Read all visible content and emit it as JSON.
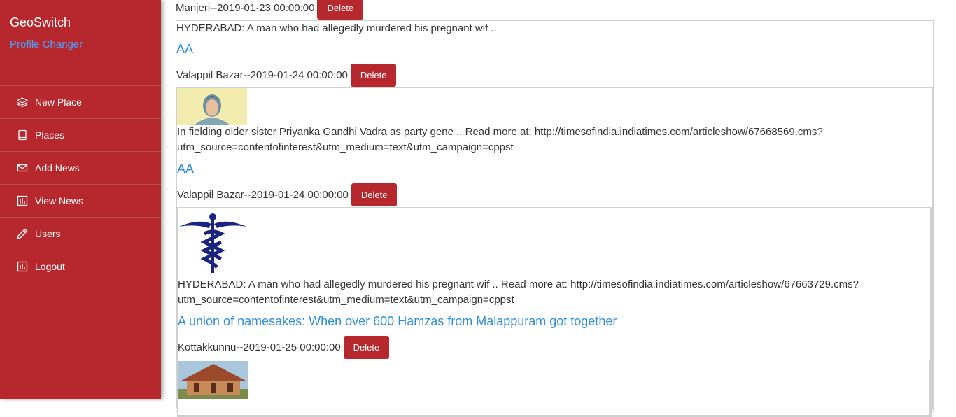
{
  "sidebar": {
    "brand": "GeoSwitch",
    "subtitle": "Profile Changer",
    "items": [
      {
        "label": "New Place",
        "icon": "layers-icon"
      },
      {
        "label": "Places",
        "icon": "tablet-icon"
      },
      {
        "label": "Add News",
        "icon": "mail-icon"
      },
      {
        "label": "View News",
        "icon": "bar-chart-icon"
      },
      {
        "label": "Users",
        "icon": "pencil-icon"
      },
      {
        "label": "Logout",
        "icon": "bar-chart-icon"
      }
    ]
  },
  "news": [
    {
      "meta": "Manjeri--2019-01-23 00:00:00",
      "delete": "Delete"
    },
    {
      "description": "HYDERABAD: A man who had allegedly murdered his pregnant wif ..",
      "title": "AA",
      "meta": "Valappil Bazar--2019-01-24 00:00:00",
      "delete": "Delete"
    },
    {
      "image": "priyanka-gandhi-portrait-image",
      "description": "In fielding older sister Priyanka Gandhi Vadra as party gene .. Read more at: http://timesofindia.indiatimes.com/articleshow/67668569.cms?",
      "description2": "utm_source=contentofinterest&utm_medium=text&utm_campaign=cppst",
      "title": "AA",
      "meta": "Valappil Bazar--2019-01-24 00:00:00",
      "delete": "Delete"
    },
    {
      "image": "caduceus-symbol-image",
      "description": "HYDERABAD: A man who had allegedly murdered his pregnant wif .. Read more at: http://timesofindia.indiatimes.com/articleshow/67663729.cms?",
      "description2": "utm_source=contentofinterest&utm_medium=text&utm_campaign=cppst",
      "title": "A union of namesakes: When over 600 Hamzas from Malappuram got together",
      "meta": "Kottakkunnu--2019-01-25 00:00:00",
      "delete": "Delete"
    },
    {
      "image": "building-photo-image"
    }
  ],
  "colors": {
    "sidebar": "#b7282e",
    "accent": "#2f8fd8",
    "subbrand": "#4aa3ff"
  }
}
